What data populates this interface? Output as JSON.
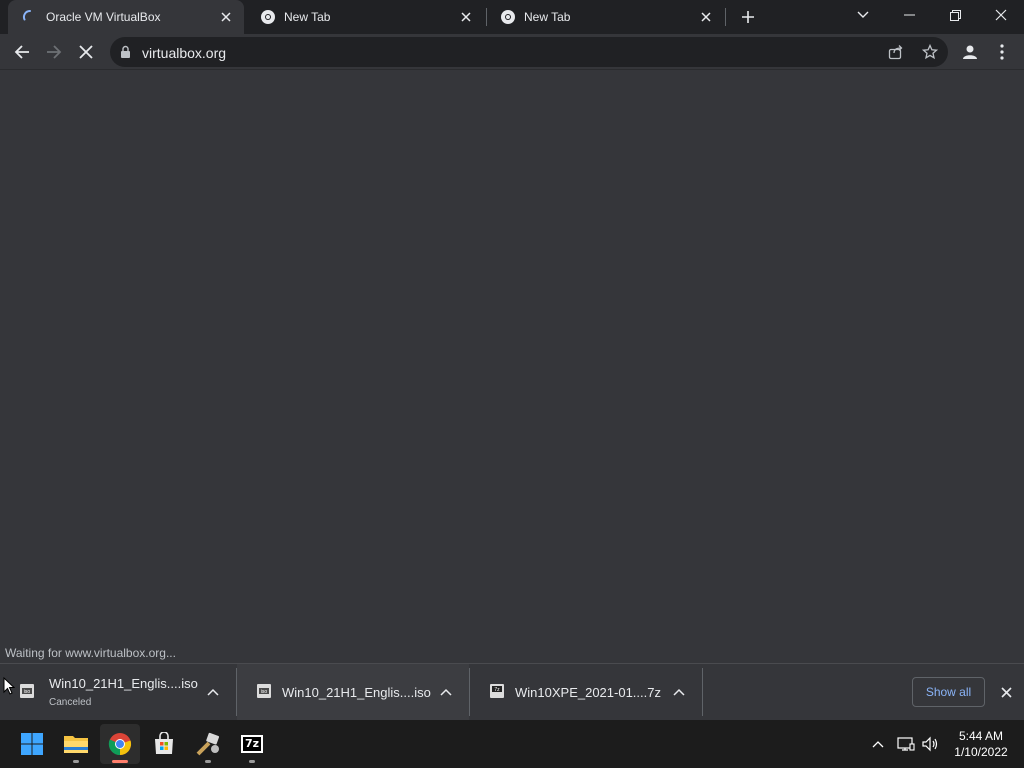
{
  "tabs": [
    {
      "title": "Oracle VM VirtualBox",
      "active": true,
      "loading": true
    },
    {
      "title": "New Tab",
      "active": false
    },
    {
      "title": "New Tab",
      "active": false
    }
  ],
  "toolbar": {
    "url": "virtualbox.org"
  },
  "status": {
    "text": "Waiting for www.virtualbox.org..."
  },
  "downloads": {
    "items": [
      {
        "name": "Win10_21H1_Englis....iso",
        "status": "Canceled",
        "icon": "iso-file-icon"
      },
      {
        "name": "Win10_21H1_Englis....iso",
        "status": "",
        "icon": "iso-file-icon"
      },
      {
        "name": "Win10XPE_2021-01....7z",
        "status": "",
        "icon": "7z-file-icon"
      }
    ],
    "show_all_label": "Show all"
  },
  "taskbar": {
    "apps": [
      "start-icon",
      "file-explorer-icon",
      "chrome-icon",
      "microsoft-store-icon",
      "tool-icon",
      "7zip-icon"
    ],
    "seven_zip_label": "7z",
    "time": "5:44 AM",
    "date": "1/10/2022"
  },
  "colors": {
    "accent": "#8ab4f8",
    "background": "#35363a",
    "tabstrip": "#202124",
    "taskbar": "#1c1c1c"
  }
}
